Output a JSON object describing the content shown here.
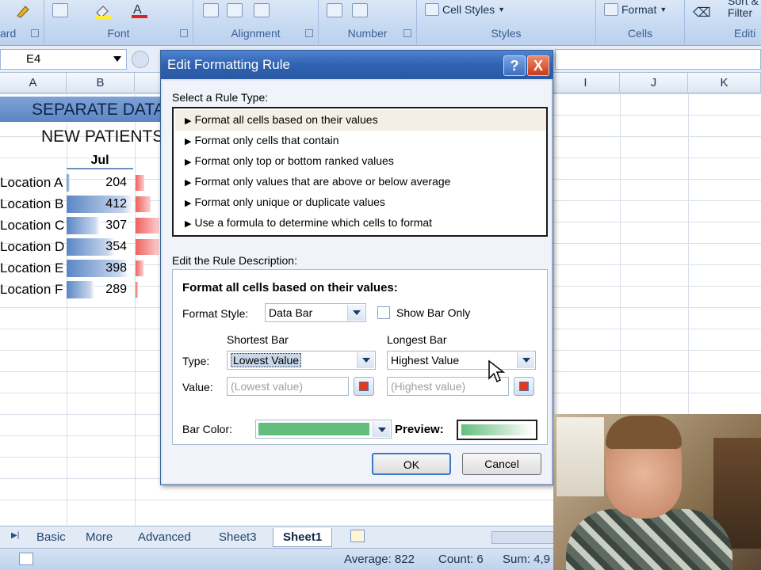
{
  "ribbon": {
    "groups": {
      "clipboard": "ard",
      "font": "Font",
      "alignment": "Alignment",
      "number": "Number",
      "styles": "Styles",
      "cells": "Cells",
      "editing": "Editi"
    },
    "cell_styles": "Cell Styles",
    "format": "Format",
    "sort_filter_1": "Sort &",
    "sort_filter_2": "Filter"
  },
  "formula_bar": {
    "name_box": "E4"
  },
  "columns": [
    "A",
    "B",
    "I",
    "J",
    "K"
  ],
  "sheet": {
    "title": "SEPARATE DATA",
    "subtitle": "NEW PATIENTS",
    "month": "Jul",
    "rows": [
      {
        "label": "Location A",
        "value": "204",
        "fill": 0.05
      },
      {
        "label": "Location B",
        "value": "412",
        "fill": 1.0
      },
      {
        "label": "Location C",
        "value": "307",
        "fill": 0.5
      },
      {
        "label": "Location D",
        "value": "354",
        "fill": 0.73
      },
      {
        "label": "Location E",
        "value": "398",
        "fill": 0.93
      },
      {
        "label": "Location F",
        "value": "289",
        "fill": 0.42
      }
    ],
    "second_column_fill": [
      0.35,
      0.6,
      0.95,
      0.95,
      0.3,
      0.1
    ]
  },
  "dialog": {
    "title": "Edit Formatting Rule",
    "help": "?",
    "close": "X",
    "select_rule_type_label": "Select a Rule Type:",
    "rule_types": [
      "Format all cells based on their values",
      "Format only cells that contain",
      "Format only top or bottom ranked values",
      "Format only values that are above or below average",
      "Format only unique or duplicate values",
      "Use a formula to determine which cells to format"
    ],
    "edit_description_label": "Edit the Rule Description:",
    "description_heading": "Format all cells based on their values:",
    "format_style_label": "Format Style:",
    "format_style_value": "Data Bar",
    "show_bar_only": "Show Bar Only",
    "shortest_bar": "Shortest Bar",
    "longest_bar": "Longest Bar",
    "type_label": "Type:",
    "value_label": "Value:",
    "shortest_type": "Lowest Value",
    "longest_type": "Highest Value",
    "shortest_value": "(Lowest value)",
    "longest_value": "(Highest value)",
    "bar_color_label": "Bar Color:",
    "preview_label": "Preview:",
    "ok": "OK",
    "cancel": "Cancel",
    "bar_color": "#63be7b"
  },
  "tabs": [
    "Basic",
    "More",
    "Advanced",
    "Sheet3",
    "Sheet1"
  ],
  "active_tab": "Sheet1",
  "status": {
    "average": "Average: 822",
    "count": "Count: 6",
    "sum": "Sum: 4,9"
  }
}
